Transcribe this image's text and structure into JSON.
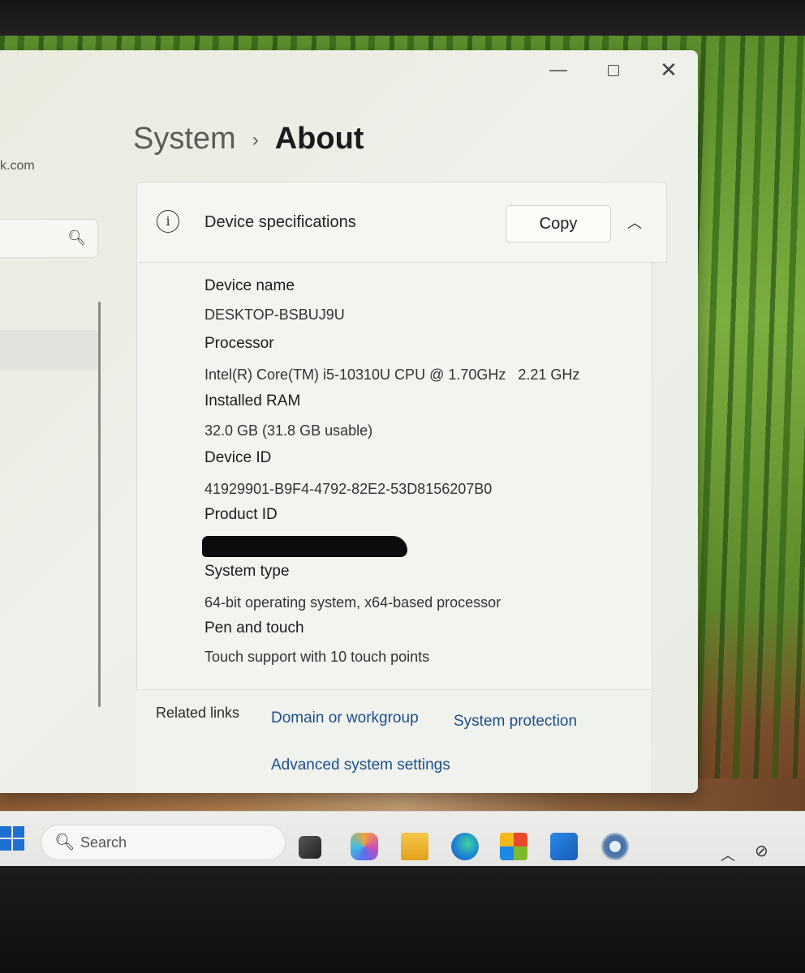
{
  "window": {
    "controls": {
      "minimize": "—",
      "close": "✕"
    },
    "sidebar": {
      "domain_fragment": "k.com",
      "search_icon": "search-icon"
    },
    "breadcrumb": {
      "parent": "System",
      "separator": "›",
      "current": "About"
    }
  },
  "device_specs": {
    "title": "Device specifications",
    "copy_label": "Copy",
    "info_icon": "ⓘ",
    "collapse_icon": "︿",
    "items": [
      {
        "label": "Device name",
        "value": "DESKTOP-BSBUJ9U"
      },
      {
        "label": "Processor",
        "value": "Intel(R) Core(TM) i5-10310U CPU @ 1.70GHz   2.21 GHz"
      },
      {
        "label": "Installed RAM",
        "value": "32.0 GB (31.8 GB usable)"
      },
      {
        "label": "Device ID",
        "value": "41929901-B9F4-4792-82E2-53D8156207B0"
      },
      {
        "label": "Product ID",
        "value": ""
      },
      {
        "label": "System type",
        "value": "64-bit operating system, x64-based processor"
      },
      {
        "label": "Pen and touch",
        "value": "Touch support with 10 touch points"
      }
    ]
  },
  "related_links": {
    "label": "Related links",
    "links": [
      "Domain or workgroup",
      "System protection",
      "Advanced system settings"
    ]
  },
  "taskbar": {
    "search_placeholder": "Search",
    "tray": {
      "chevron": "︿",
      "network": "⊘"
    },
    "apps": [
      "task-view-icon",
      "copilot-icon",
      "file-explorer-icon",
      "edge-icon",
      "store-icon",
      "outlook-icon",
      "settings-icon"
    ]
  },
  "colors": {
    "accent": "#1d6fd1",
    "link": "#1d4f8c"
  }
}
